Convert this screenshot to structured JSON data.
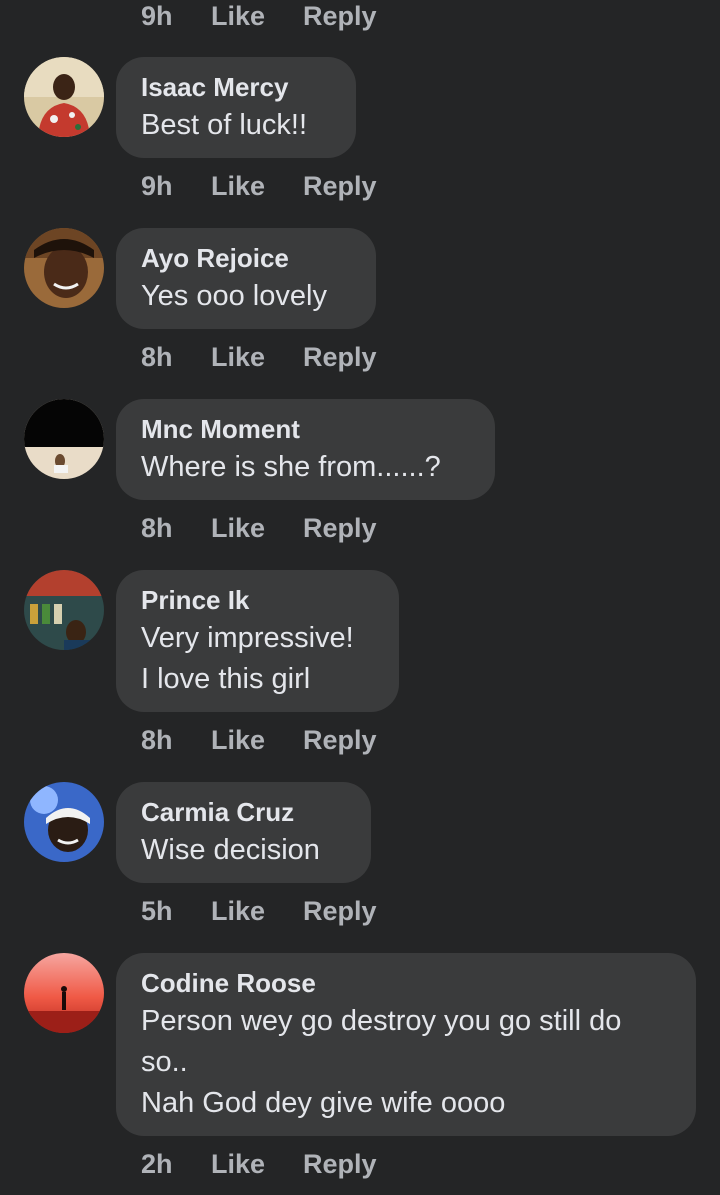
{
  "top_actions": {
    "time": "9h",
    "like": "Like",
    "reply": "Reply"
  },
  "comments": [
    {
      "author": "Isaac Mercy",
      "lines": [
        "Best of luck!!"
      ],
      "time": "9h",
      "like": "Like",
      "reply": "Reply"
    },
    {
      "author": "Ayo Rejoice",
      "lines": [
        "Yes ooo lovely"
      ],
      "time": "8h",
      "like": "Like",
      "reply": "Reply"
    },
    {
      "author": "Mnc Moment",
      "lines": [
        "Where is she from......?"
      ],
      "time": "8h",
      "like": "Like",
      "reply": "Reply"
    },
    {
      "author": "Prince Ik",
      "lines": [
        "Very impressive!",
        "I love this girl"
      ],
      "time": "8h",
      "like": "Like",
      "reply": "Reply"
    },
    {
      "author": "Carmia Cruz",
      "lines": [
        "Wise decision"
      ],
      "time": "5h",
      "like": "Like",
      "reply": "Reply"
    },
    {
      "author": "Codine Roose",
      "lines": [
        "Person wey go destroy you go still do",
        "so..",
        "Nah God dey give wife oooo"
      ],
      "time": "2h",
      "like": "Like",
      "reply": "Reply"
    }
  ],
  "colors": {
    "background": "#242526",
    "bubble": "#3a3b3c",
    "text": "#e4e6eb",
    "secondary": "#b0b3b8"
  }
}
